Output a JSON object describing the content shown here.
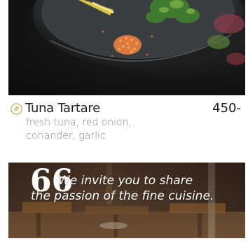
{
  "hero": {
    "image": "plated-dish-photo"
  },
  "menu_item": {
    "icon": "leaf-badge-icon",
    "title": "Tuna Tartare",
    "price": "450-",
    "description_lines": [
      "fresh tuna, red onion,",
      "coriander, garlic"
    ]
  },
  "banner": {
    "quote_mark": "66",
    "line1": "We invite you to share",
    "line2": "the passion of the fine cuisine."
  },
  "colors": {
    "accent_icon": "#c9b86a",
    "title": "#222222",
    "description": "#8a8a8a",
    "banner_text": "#ffffff"
  }
}
